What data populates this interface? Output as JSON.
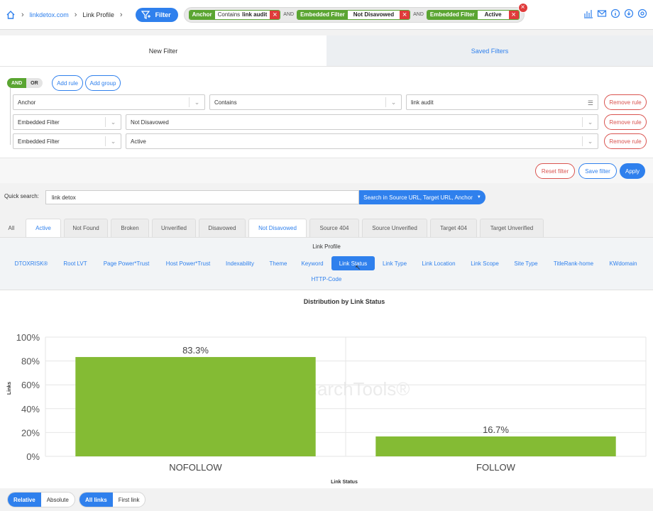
{
  "breadcrumb": {
    "site": "linkdetox.com",
    "page": "Link Profile"
  },
  "filter_button": "Filter",
  "active_filters": [
    {
      "field": "Anchor",
      "operator": "Contains",
      "value": "link audit"
    },
    {
      "field": "Embedded Filter",
      "operator": "",
      "value": "Not Disavowed"
    },
    {
      "field": "Embedded Filter",
      "operator": "",
      "value": "Active"
    }
  ],
  "and_label": "AND",
  "filter_tabs": {
    "new": "New Filter",
    "saved": "Saved Filters"
  },
  "builder": {
    "and": "AND",
    "or": "OR",
    "add_rule": "Add rule",
    "add_group": "Add group",
    "rules": [
      {
        "field": "Anchor",
        "operator": "Contains",
        "value": "link audit"
      },
      {
        "field": "Embedded Filter",
        "value": "Not Disavowed"
      },
      {
        "field": "Embedded Filter",
        "value": "Active"
      }
    ],
    "remove_rule": "Remove rule"
  },
  "panel_footer": {
    "reset": "Reset filter",
    "save": "Save filter",
    "apply": "Apply"
  },
  "quick_search": {
    "label": "Quick search:",
    "value": "link detox",
    "scope": "Search in Source URL, Target URL, Anchor"
  },
  "status_tabs": [
    "All",
    "Active",
    "Not Found",
    "Broken",
    "Unverified",
    "Disavowed",
    "Not Disavowed",
    "Source 404",
    "Source Unverified",
    "Target 404",
    "Target Unverified"
  ],
  "link_profile": {
    "title": "Link Profile",
    "tabs": [
      "DTOXRISK®",
      "Root LVT",
      "Page Power*Trust",
      "Host Power*Trust",
      "Indexability",
      "Theme",
      "Keyword",
      "Link Status",
      "Link Type",
      "Link Location",
      "Link Scope",
      "Site Type",
      "TitleRank-home",
      "KWdomain",
      "HTTP-Code"
    ],
    "active_tab": "Link Status"
  },
  "chart_data": {
    "type": "bar",
    "title": "Distribution by Link Status",
    "categories": [
      "NOFOLLOW",
      "FOLLOW"
    ],
    "values": [
      83.3,
      16.7
    ],
    "value_labels": [
      "83.3%",
      "16.7%"
    ],
    "xlabel": "Link Status",
    "ylabel": "Links",
    "ylim": [
      0,
      100
    ],
    "yticks": [
      "0%",
      "20%",
      "40%",
      "60%",
      "80%",
      "100%"
    ],
    "grid": true,
    "color": "#84bb34",
    "watermark": "LinkResearchTools®"
  },
  "bottom_toggles": {
    "relative": "Relative",
    "absolute": "Absolute",
    "all_links": "All links",
    "first_link": "First link"
  },
  "colors": {
    "accent": "#2f80ed",
    "green": "#5aa531",
    "danger": "#e03b3b"
  }
}
